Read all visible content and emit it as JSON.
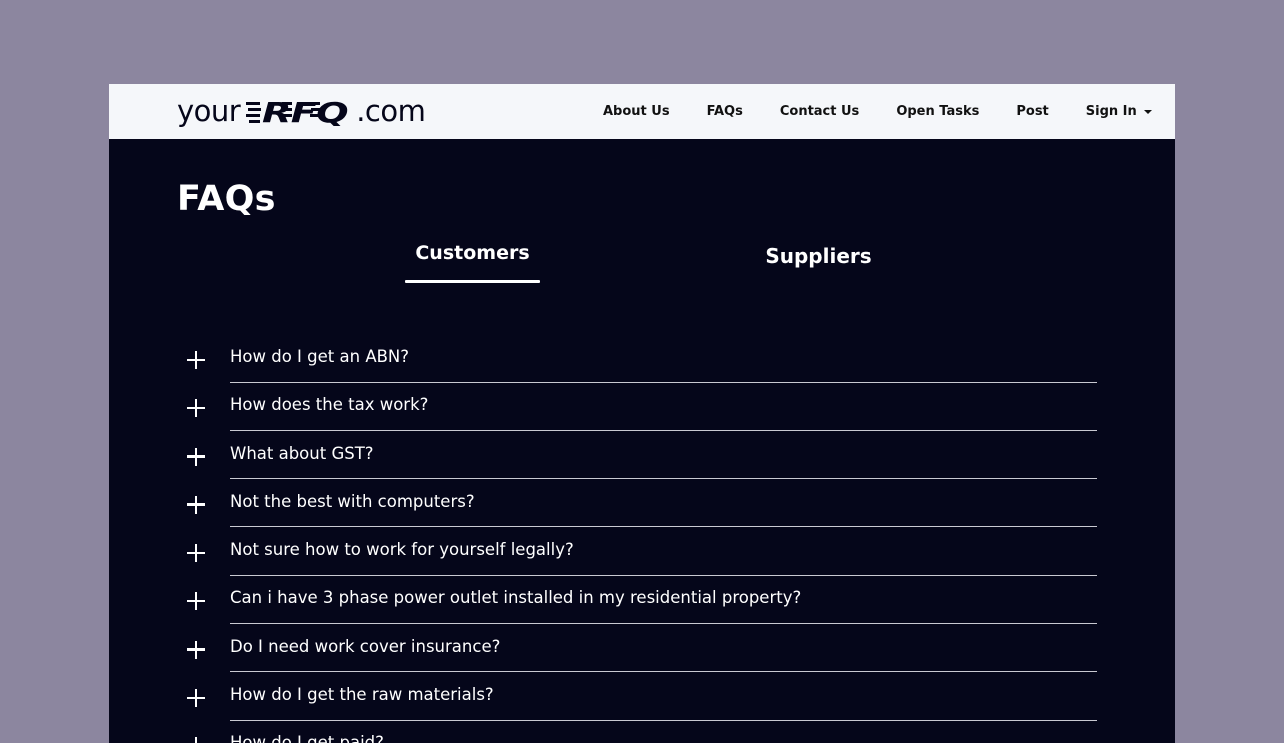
{
  "header": {
    "logo": {
      "prefix": "your",
      "mark": "RFQ",
      "suffix": ".com"
    },
    "nav": [
      {
        "label": "About Us"
      },
      {
        "label": "FAQs"
      },
      {
        "label": "Contact Us"
      },
      {
        "label": "Open Tasks"
      },
      {
        "label": "Post"
      },
      {
        "label": "Sign In"
      }
    ]
  },
  "page": {
    "title": "FAQs",
    "tabs": [
      {
        "label": "Customers",
        "active": true
      },
      {
        "label": "Suppliers",
        "active": false
      }
    ]
  },
  "faqs": [
    {
      "question": "How do I get an ABN?"
    },
    {
      "question": "How does the tax work?"
    },
    {
      "question": "What about GST?"
    },
    {
      "question": "Not the best with computers?"
    },
    {
      "question": "Not sure how to work for yourself legally?"
    },
    {
      "question": "Can i have 3 phase power outlet installed in my residential property?"
    },
    {
      "question": "Do I need work cover insurance?"
    },
    {
      "question": "How do I get the raw materials?"
    },
    {
      "question": "How do I get paid?"
    }
  ],
  "colors": {
    "background": "#8c869f",
    "content": "#05061a",
    "navbar": "#f5f7fa",
    "text_on_dark": "#ffffff"
  }
}
